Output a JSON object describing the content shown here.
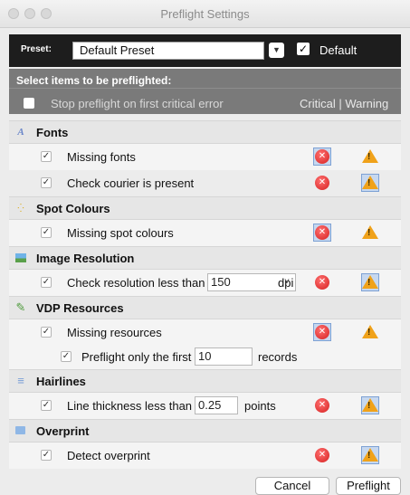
{
  "window": {
    "title": "Preflight Settings"
  },
  "preset": {
    "label": "Preset:",
    "value": "Default Preset",
    "default_checked": true,
    "default_label": "Default"
  },
  "header": {
    "title": "Select items to be preflighted:",
    "stop_label": "Stop preflight on first critical error",
    "critical_warning_label": "Critical | Warning"
  },
  "sections": {
    "fonts": {
      "title": "Fonts",
      "icon": "font-icon",
      "missing_fonts": {
        "label": "Missing fonts",
        "checked": true,
        "selected": "critical"
      },
      "courier": {
        "label": "Check courier is present",
        "checked": true,
        "selected": "warning"
      }
    },
    "spot": {
      "title": "Spot Colours",
      "icon": "spot-colours-icon",
      "missing_spot": {
        "label": "Missing spot colours",
        "checked": true,
        "selected": "critical"
      }
    },
    "image": {
      "title": "Image Resolution",
      "icon": "image-icon",
      "resolution": {
        "label": "Check resolution less than",
        "value": "150",
        "unit": "dpi",
        "checked": true,
        "selected": "warning"
      }
    },
    "vdp": {
      "title": "VDP Resources",
      "icon": "vdp-icon",
      "missing_resources": {
        "label": "Missing resources",
        "checked": true,
        "selected": "critical"
      },
      "first_records": {
        "label": "Preflight only the first",
        "value": "10",
        "unit": "records",
        "checked": true
      }
    },
    "hairlines": {
      "title": "Hairlines",
      "icon": "hairlines-icon",
      "thickness": {
        "label": "Line thickness less than",
        "value": "0.25",
        "unit": "points",
        "checked": true,
        "selected": "warning"
      }
    },
    "overprint": {
      "title": "Overprint",
      "icon": "overprint-icon",
      "detect": {
        "label": "Detect overprint",
        "checked": true,
        "selected": "warning"
      }
    }
  },
  "buttons": {
    "cancel": "Cancel",
    "preflight": "Preflight"
  },
  "colors": {
    "error": "#d62020",
    "warning": "#f0a21a",
    "selected_highlight": "#c7d8ef"
  }
}
